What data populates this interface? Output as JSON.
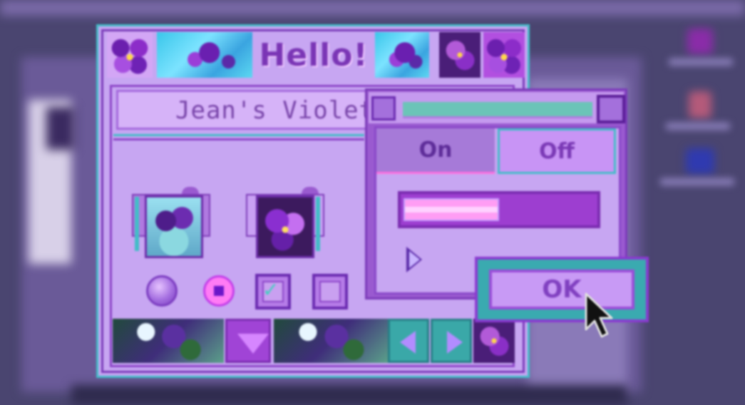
{
  "window": {
    "title": "Hello!"
  },
  "panel": {
    "label": "Jean's Violets"
  },
  "popup": {
    "toggle_on_label": "On",
    "toggle_off_label": "Off",
    "selected_toggle": "On",
    "slider_fill_fraction": 0.5,
    "ok_label": "OK"
  },
  "controls": {
    "radio_1_selected": false,
    "radio_2_selected": true,
    "checkbox_1_checked": true,
    "checkbox_2_checked": false
  },
  "icons": {
    "images": [
      "violet-photo-icon",
      "violet-photo-icon"
    ],
    "nav": [
      "triangle-up-icon",
      "arrow-left-icon",
      "arrow-right-icon",
      "play-triangle-icon",
      "cursor-icon"
    ]
  },
  "colors": {
    "window_bg": "#c7a6f2",
    "border_teal": "#42bdc7",
    "border_purple": "#7a3ab8",
    "accent_pink": "#ff7bf5",
    "desktop_bg": "#4a4570"
  }
}
